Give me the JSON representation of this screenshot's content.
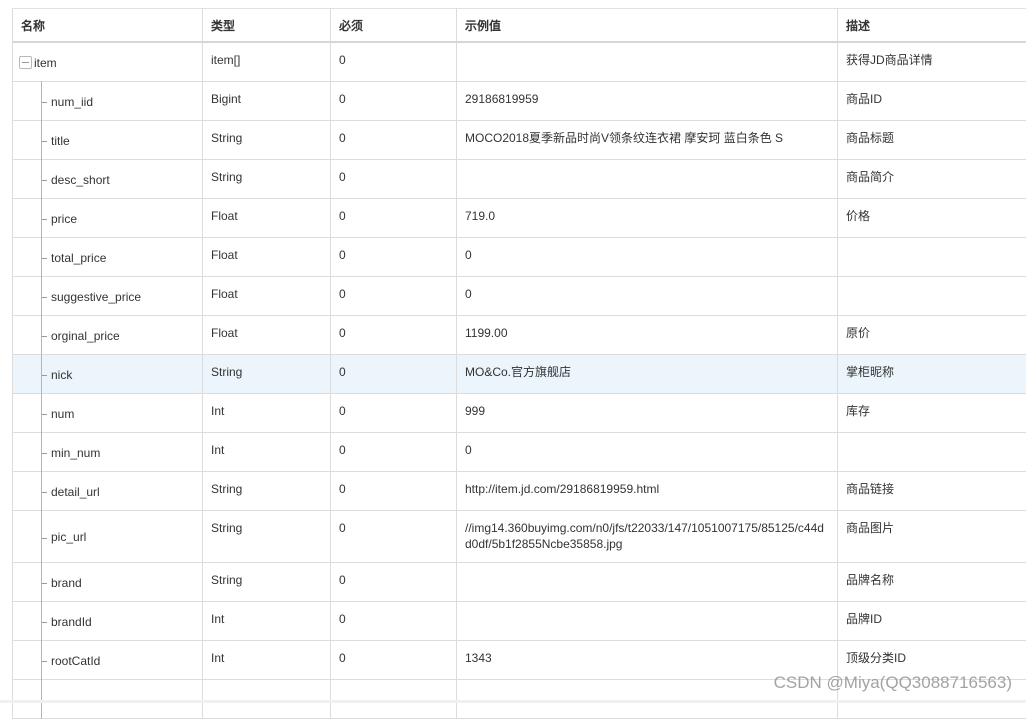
{
  "table": {
    "columns": [
      "名称",
      "类型",
      "必须",
      "示例值",
      "描述"
    ],
    "root": {
      "name": "item",
      "type": "item[]",
      "required": "0",
      "example": "",
      "description": "获得JD商品详情"
    },
    "rows": [
      {
        "name": "num_iid",
        "type": "Bigint",
        "required": "0",
        "example": "29186819959",
        "description": "商品ID"
      },
      {
        "name": "title",
        "type": "String",
        "required": "0",
        "example": "MOCO2018夏季新品时尚V领条纹连衣裙 摩安珂 蓝白条色 S",
        "description": "商品标题"
      },
      {
        "name": "desc_short",
        "type": "String",
        "required": "0",
        "example": "",
        "description": "商品简介"
      },
      {
        "name": "price",
        "type": "Float",
        "required": "0",
        "example": "719.0",
        "description": "价格"
      },
      {
        "name": "total_price",
        "type": "Float",
        "required": "0",
        "example": "0",
        "description": ""
      },
      {
        "name": "suggestive_price",
        "type": "Float",
        "required": "0",
        "example": "0",
        "description": ""
      },
      {
        "name": "orginal_price",
        "type": "Float",
        "required": "0",
        "example": "1199.00",
        "description": "原价"
      },
      {
        "name": "nick",
        "type": "String",
        "required": "0",
        "example": "MO&Co.官方旗舰店",
        "description": "掌柜昵称"
      },
      {
        "name": "num",
        "type": "Int",
        "required": "0",
        "example": "999",
        "description": "库存"
      },
      {
        "name": "min_num",
        "type": "Int",
        "required": "0",
        "example": "0",
        "description": ""
      },
      {
        "name": "detail_url",
        "type": "String",
        "required": "0",
        "example": "http://item.jd.com/29186819959.html",
        "description": "商品链接"
      },
      {
        "name": "pic_url",
        "type": "String",
        "required": "0",
        "example": "//img14.360buyimg.com/n0/jfs/t22033/147/1051007175/85125/c44dd0df/5b1f2855Ncbe35858.jpg",
        "description": "商品图片"
      },
      {
        "name": "brand",
        "type": "String",
        "required": "0",
        "example": "",
        "description": "品牌名称"
      },
      {
        "name": "brandId",
        "type": "Int",
        "required": "0",
        "example": "",
        "description": "品牌ID"
      },
      {
        "name": "rootCatId",
        "type": "Int",
        "required": "0",
        "example": "1343",
        "description": "顶级分类ID"
      },
      {
        "name": "",
        "type": "",
        "required": "",
        "example": "",
        "description": ""
      }
    ],
    "highlighted_row": "nick"
  },
  "icons": {
    "expand": "collapse-minus-icon"
  },
  "colors": {
    "highlight_row": "#ebf5fb",
    "border": "#dcdcdc",
    "text": "#333333"
  },
  "watermark": "CSDN @Miya(QQ3088716563)"
}
